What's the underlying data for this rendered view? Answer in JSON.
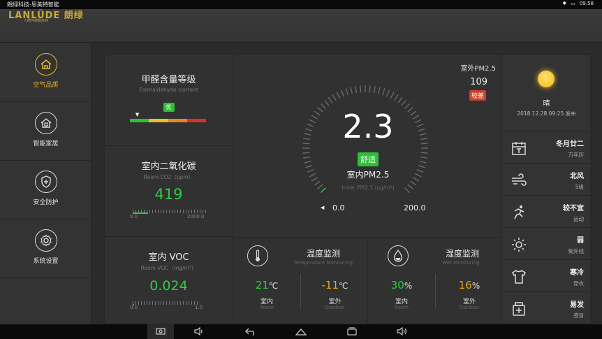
{
  "status": {
    "title": "朗绿科技-思美特智能",
    "time": "09:58"
  },
  "logo": {
    "text": "LANLÜDE 朗绿",
    "sub": "人居环境服务商"
  },
  "sidebar": {
    "items": [
      {
        "label": "空气品质",
        "icon": "home-icon",
        "active": true
      },
      {
        "label": "智能家居",
        "icon": "house-icon",
        "active": false
      },
      {
        "label": "安全防护",
        "icon": "shield-icon",
        "active": false
      },
      {
        "label": "系统设置",
        "icon": "gear-icon",
        "active": false
      }
    ]
  },
  "formaldehyde": {
    "title": "甲醛含量等级",
    "subtitle": "Formaldehyde content",
    "badge": "优",
    "level": 0.1,
    "colors": [
      "#2fbf38",
      "#e6c22a",
      "#e8842a",
      "#d9302a"
    ]
  },
  "co2": {
    "title": "室内二氧化碳",
    "subtitle": "Room CO2（ppm）",
    "value": "419",
    "min": "0.0",
    "max": "2000.0",
    "fraction": 0.21
  },
  "voc": {
    "title": "室内 VOC",
    "subtitle": "Room VOC（mg/m³）",
    "value": "0.024",
    "min": "0.0",
    "max": "1.0",
    "fraction": 0.024
  },
  "pm": {
    "outdoor_label": "室外PM2.5",
    "outdoor_value": "109",
    "outdoor_badge": "较差",
    "value": "2.3",
    "badge": "舒适",
    "label": "室内PM2.5",
    "sublabel": "Inner PM2.5 (ug/m³)",
    "min": "0.0",
    "max": "200.0",
    "fraction": 0.0115
  },
  "temperature": {
    "title": "温度监测",
    "subtitle": "Temperature Monitoring",
    "indoor_value": "21",
    "indoor_unit": "℃",
    "indoor_label": "室内",
    "indoor_sub": "Room",
    "outdoor_value": "-11",
    "outdoor_unit": "℃",
    "outdoor_label": "室外",
    "outdoor_sub": "Outdoor"
  },
  "humidity": {
    "title": "湿度监测",
    "subtitle": "Wet Monitoring",
    "indoor_value": "30",
    "indoor_unit": "%",
    "indoor_label": "室内",
    "indoor_sub": "Room",
    "outdoor_value": "16",
    "outdoor_unit": "%",
    "outdoor_label": "室外",
    "outdoor_sub": "Outdoor"
  },
  "weather": {
    "condition": "晴",
    "published": "2018.12.28 09:25 发布",
    "rows": [
      {
        "value": "冬月廿二",
        "key": "万年历",
        "icon": "calendar-icon"
      },
      {
        "value": "北风",
        "key": "5级",
        "icon": "wind-icon"
      },
      {
        "value": "较不宜",
        "key": "运动",
        "icon": "running-icon"
      },
      {
        "value": "弱",
        "key": "紫外线",
        "icon": "sun-outline-icon"
      },
      {
        "value": "寒冷",
        "key": "穿衣",
        "icon": "shirt-icon"
      },
      {
        "value": "易发",
        "key": "感冒",
        "icon": "medicine-icon"
      }
    ]
  },
  "colors": {
    "green": "#2fcc44",
    "orange": "#e7a417",
    "gold": "#e7b92a",
    "red_badge": "#c7432b"
  }
}
